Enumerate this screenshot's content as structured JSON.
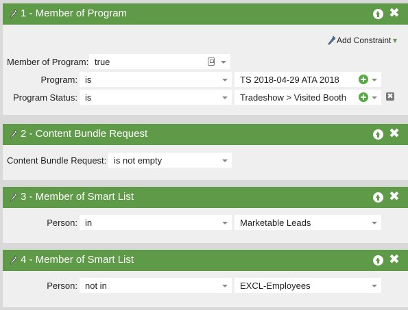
{
  "add_constraint": {
    "label": "Add Constraint",
    "caret": "▾"
  },
  "filters": [
    {
      "title": "1 - Member of Program",
      "rows": [
        {
          "label": "Member of Program:",
          "value": "true"
        },
        {
          "label": "Program:",
          "operator": "is",
          "value": "TS 2018-04-29 ATA 2018"
        },
        {
          "label": "Program Status:",
          "operator": "is",
          "value": "Tradeshow > Visited Booth"
        }
      ]
    },
    {
      "title": "2 - Content Bundle Request",
      "rows": [
        {
          "label": "Content Bundle Request:",
          "operator": "is not empty"
        }
      ]
    },
    {
      "title": "3 - Member of Smart List",
      "rows": [
        {
          "label": "Person:",
          "operator": "in",
          "value": "Marketable Leads"
        }
      ]
    },
    {
      "title": "4 - Member of Smart List",
      "rows": [
        {
          "label": "Person:",
          "operator": "not in",
          "value": "EXCL-Employees"
        }
      ]
    }
  ],
  "icons": {
    "wrench": "wrench-icon",
    "move_up": "arrow-up-circle-icon",
    "close": "close-icon",
    "add": "plus-circle-icon",
    "remove": "remove-icon",
    "calculator": "calculator-icon"
  },
  "colors": {
    "header_green": "#5e9a47",
    "panel_bg": "#efefef",
    "page_bg": "#d9d9d9",
    "plus_green": "#4fae3f"
  },
  "glyphs": {
    "close": "✖",
    "remove": "✖"
  }
}
